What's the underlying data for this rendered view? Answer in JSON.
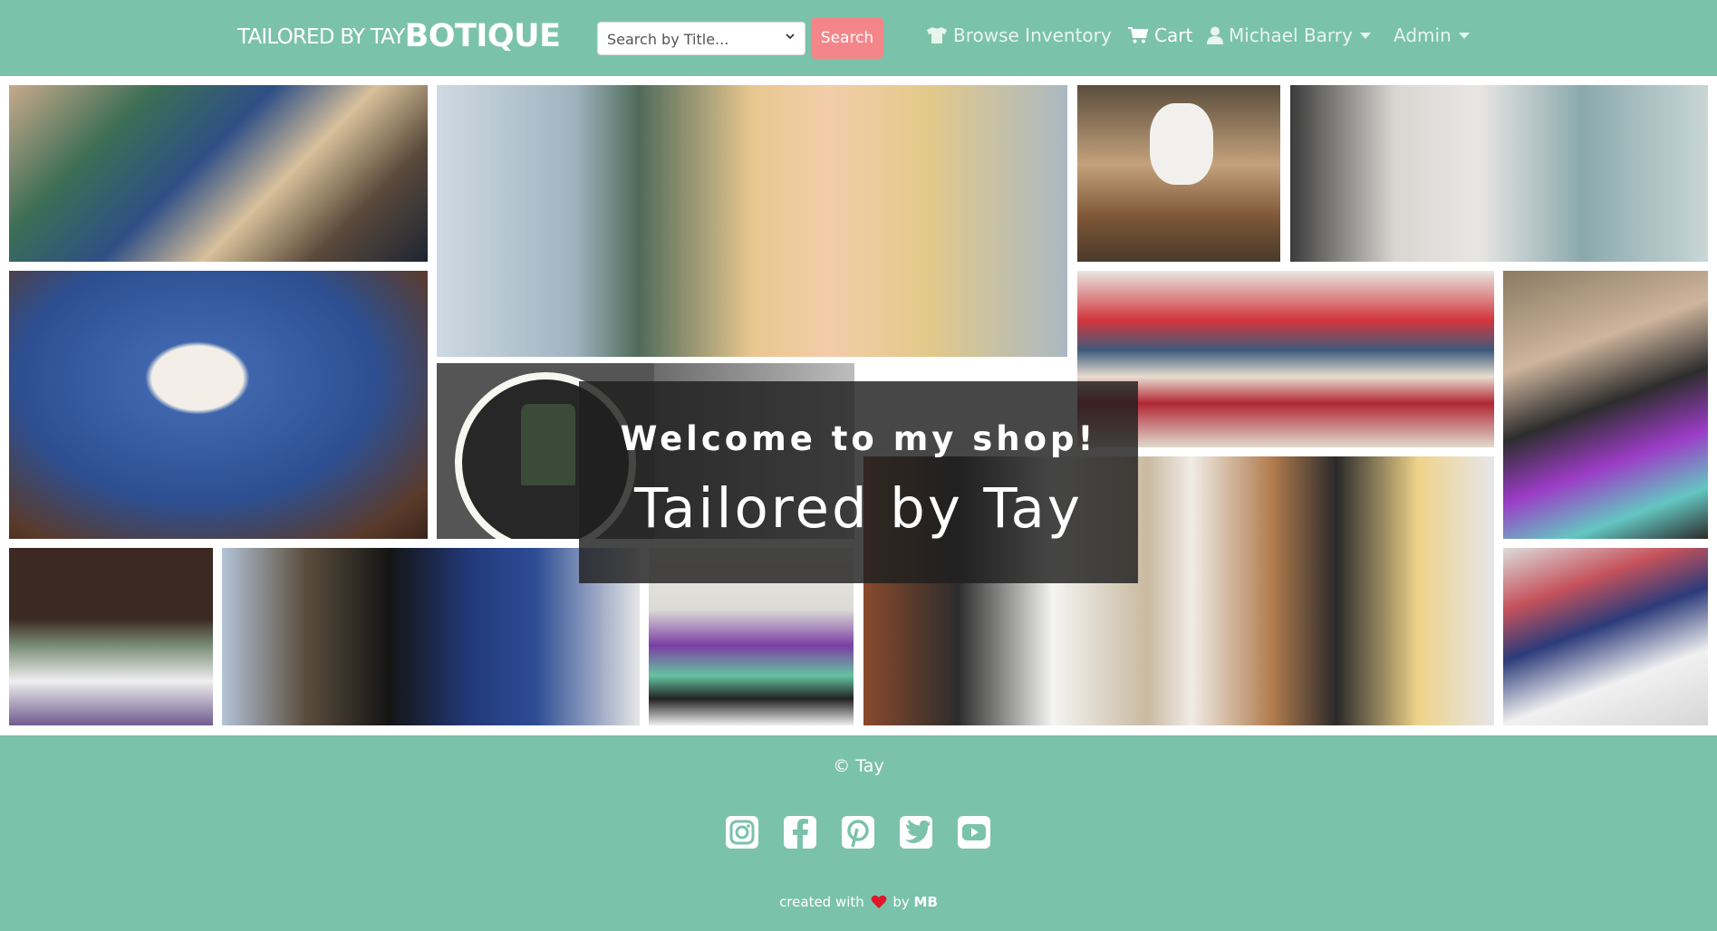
{
  "header": {
    "brand_small": "TAILORED BY TAY",
    "brand_big": "BOTIQUE",
    "search_placeholder": "Search by Title...",
    "search_button": "Search",
    "nav": {
      "browse": "Browse Inventory",
      "cart": "Cart",
      "user": "Michael Barry",
      "admin": "Admin"
    }
  },
  "hero": {
    "welcome": "Welcome to my shop!",
    "title": "Tailored by Tay",
    "tiles": [
      "folded-clothes-photo",
      "mountain-portrait-photo",
      "cat-on-box-photo",
      "sleeping-cat-photo",
      "cat-in-blue-bag-photo",
      "ring-light-jacket-photo",
      "folded-sweaters-photo",
      "woman-with-packages-photo",
      "kitchen-boxes-photo",
      "dog-mailbox-photo",
      "packages-stack-photo",
      "group-masks-photo",
      "clothes-rack-photo"
    ]
  },
  "footer": {
    "copyright": "© Tay",
    "social": [
      "instagram-icon",
      "facebook-icon",
      "pinterest-icon",
      "twitter-icon",
      "youtube-icon"
    ],
    "credit_prefix": "created with",
    "credit_by": "by",
    "credit_author": "MB"
  },
  "colors": {
    "primary": "#7bc2ab",
    "search_button": "#f4868a",
    "overlay": "#1e1e1e",
    "heart": "#e0162b"
  }
}
